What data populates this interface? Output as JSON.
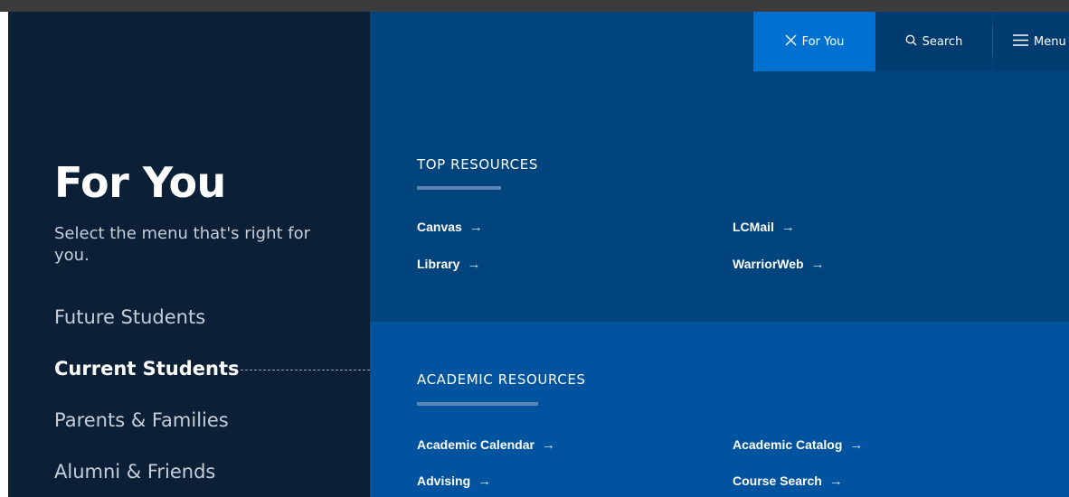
{
  "header": {
    "for_you_label": "For You",
    "search_label": "Search",
    "menu_label": "Menu"
  },
  "sidebar": {
    "title": "For You",
    "subtitle": "Select the menu that's right for you.",
    "items": [
      {
        "label": "Future Students",
        "active": false
      },
      {
        "label": "Current Students",
        "active": true
      },
      {
        "label": "Parents & Families",
        "active": false
      },
      {
        "label": "Alumni & Friends",
        "active": false
      }
    ]
  },
  "top_resources": {
    "heading": "TOP RESOURCES",
    "links": [
      "Canvas",
      "LCMail",
      "Library",
      "WarriorWeb"
    ]
  },
  "academic_resources": {
    "heading": "ACADEMIC RESOURCES",
    "links": [
      "Academic Calendar",
      "Academic Catalog",
      "Advising",
      "Course Search"
    ]
  },
  "icons": {
    "close": "close-icon",
    "search": "search-icon",
    "menu": "hamburger-menu-icon",
    "link_arrow": "arrow-right-icon"
  },
  "colors": {
    "sidebar_bg": "#0b1f36",
    "panel_top_bg": "#00447e",
    "panel_bottom_bg": "#00539e",
    "active_tab_bg": "#0070d1",
    "nav_bg": "#003c70"
  }
}
